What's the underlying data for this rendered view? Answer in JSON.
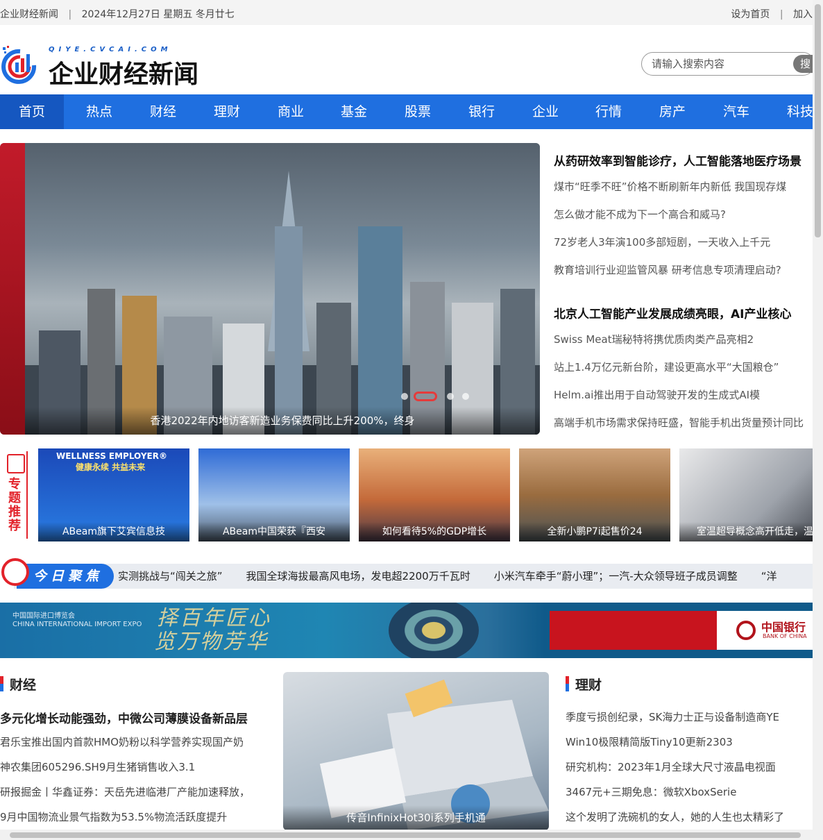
{
  "topbar": {
    "site_name": "企业财经新闻",
    "separator": "|",
    "date": "2024年12月27日 星期五 冬月廿七",
    "set_home": "设为首页",
    "add_fav": "加入"
  },
  "logo": {
    "small_text": "QIYE.CVCAI.COM",
    "big_text": "企业财经新闻"
  },
  "search": {
    "placeholder": "请输入搜索内容",
    "button": "搜"
  },
  "nav": {
    "items": [
      "首页",
      "热点",
      "财经",
      "理财",
      "商业",
      "基金",
      "股票",
      "银行",
      "企业",
      "行情",
      "房产",
      "汽车",
      "科技"
    ],
    "active_index": 0
  },
  "hero": {
    "caption": "香港2022年内地访客新造业务保费同比上升200%，终身",
    "slide_count": 4,
    "active_slide": 1
  },
  "headlines": {
    "group1_title": "从药研效率到智能诊疗，人工智能落地医疗场景",
    "group1_items": [
      "煤市“旺季不旺”价格不断刷新年内新低 我国现存煤",
      "怎么做才能不成为下一个高合和威马?",
      "72岁老人3年演100多部短剧，一天收入上千元",
      "教育培训行业迎监管风暴 研考信息专项清理启动?"
    ],
    "group2_title": "北京人工智能产业发展成绩亮眼，AI产业核心",
    "group2_items": [
      "Swiss Meat瑞秘特将携优质肉类产品亮相2",
      "站上1.4万亿元新台阶，建设更高水平“大国粮仓”",
      "Helm.ai推出用于自动驾驶开发的生成式AI模",
      "高端手机市场需求保持旺盛，智能手机出货量预计同比"
    ]
  },
  "topics": {
    "label": "专题推荐",
    "cards": [
      {
        "caption": "ABeam旗下艾宾信息技",
        "headline": "WELLNESS EMPLOYER®",
        "sub": "健康永续 共益未来"
      },
      {
        "caption": "ABeam中国荣获『西安"
      },
      {
        "caption": "如何看待5%的GDP增长"
      },
      {
        "caption": "全新小鹏P7i起售价24"
      },
      {
        "caption": "室温超导概念高开低走，温"
      }
    ]
  },
  "focus": {
    "label": "今日聚焦",
    "ticker": [
      "实测挑战与“闯关之旅”",
      "我国全球海拔最高风电场，发电超2200万千瓦时",
      "小米汽车牵手“蔚小理”；一汽-大众领导班子成员调整",
      "“洋"
    ]
  },
  "banner": {
    "calligraphy_line1": "择百年匠心",
    "calligraphy_line2": "览万物芳华",
    "cie_line1": "中国国际进口博览会",
    "cie_line2": "CHINA INTERNATIONAL IMPORT EXPO",
    "bank_cn": "中国银行",
    "bank_en": "BANK OF CHINA"
  },
  "finance": {
    "title": "财经",
    "lead": "多元化增长动能强劲，中微公司薄膜设备新品层",
    "items": [
      "君乐宝推出国内首款HMO奶粉以科学营养实现国产奶",
      "神农集团605296.SH9月生猪销售收入3.1",
      "研报掘金丨华鑫证券：天岳先进临港厂产能加速释放，",
      "9月中国物流业景气指数为53.5%物流活跃度提升"
    ]
  },
  "middle_image": {
    "caption": "传音InfinixHot30i系列手机通"
  },
  "wealth": {
    "title": "理财",
    "items": [
      "季度亏损创纪录，SK海力士正与设备制造商YE",
      "Win10极限精简版Tiny10更新2303",
      "研究机构：2023年1月全球大尺寸液晶电视面",
      "3467元+三期免息：微软XboxSerie",
      "这个发明了洗碗机的女人，她的人生也太精彩了"
    ]
  },
  "colors": {
    "nav_blue": "#1f6fe0",
    "accent_red": "#e2222a"
  }
}
